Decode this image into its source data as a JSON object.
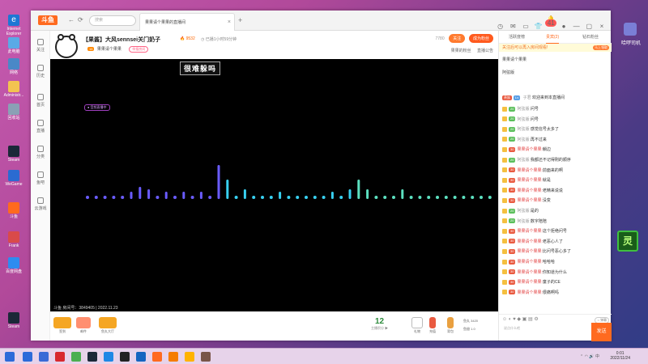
{
  "desktop": {
    "icons": [
      {
        "label": "Internet Explorer",
        "color": "#1e77d4"
      },
      {
        "label": "此电脑",
        "color": "#5aa9e6"
      },
      {
        "label": "网络",
        "color": "#4a88c7"
      },
      {
        "label": "Administr...",
        "color": "#f3c350"
      },
      {
        "label": "回收站",
        "color": "#8aa0b5"
      },
      {
        "label": "Steam",
        "color": "#1b2838"
      },
      {
        "label": "WeGame",
        "color": "#2b6bd1"
      },
      {
        "label": "斗鱼",
        "color": "#ff6a1f"
      },
      {
        "label": "Frank",
        "color": "#d94a4a"
      },
      {
        "label": "百度网盘",
        "color": "#2d8cf0"
      },
      {
        "label": "Steam",
        "color": "#1b2838"
      }
    ],
    "right_label": "哈啰司机"
  },
  "browser": {
    "logo": "斗鱼",
    "search_placeholder": "搜索",
    "tab_title": "果果请个果果的直播间",
    "notification_count": "41"
  },
  "sidebar": {
    "items": [
      {
        "label": "关注"
      },
      {
        "label": "历史"
      },
      {
        "label": "首页"
      },
      {
        "label": "直播"
      },
      {
        "label": "分类"
      },
      {
        "label": "鱼吧"
      },
      {
        "label": "云游戏"
      }
    ]
  },
  "room": {
    "title": "【果酱】大风sennsei关门奶子",
    "hot": "9532",
    "follow_time": "已播1小时59分钟",
    "streamer_level": "16",
    "streamer_name": "果果请个果果",
    "report_label": "举报房间",
    "fans_count": "7780",
    "follow_label": "关注",
    "subscribe_label": "成为粉丝",
    "level_label": "果果的粉丝",
    "announce_label": "直播公告"
  },
  "video": {
    "overlay_title": "很难躲吗",
    "playing_tag": "● 音频直播中",
    "footer": "斗鱼 房间号：3849405 | 2022.11.23"
  },
  "bottom_bar": {
    "items": [
      {
        "label": "签到",
        "color": "#f5a623"
      },
      {
        "label": "邮件",
        "color": "#ff8f70"
      },
      {
        "label": "鱼丸大厅",
        "color": "#f5a623"
      }
    ],
    "score": "12",
    "score_label": "主播积分 ▶",
    "gift_label": "礼物",
    "charge_label": "充值",
    "backpack_label": "背包",
    "fish_balls_label": "鱼丸",
    "fish_balls_value": "3420",
    "fish_wings_label": "鱼翅",
    "fish_wings_value": "1.0"
  },
  "right_panel": {
    "tabs": [
      {
        "label": "活跃度榜"
      },
      {
        "label": "贵宾(2)"
      },
      {
        "label": "钻石粉丝"
      }
    ],
    "notice": "关注后可以再入房间观看!",
    "notice_btn": "马上领取",
    "line1": "果果请个果果",
    "line2": "阿弦版",
    "welcome_prefix": "欢迎来到本直播间",
    "welcome_user": "子君",
    "messages": [
      {
        "level": "20",
        "lv_color": "green",
        "user": "阿弦版:",
        "user_red": false,
        "text": "问号"
      },
      {
        "level": "20",
        "lv_color": "green",
        "user": "阿弦版:",
        "user_red": false,
        "text": "问号"
      },
      {
        "level": "20",
        "lv_color": "green",
        "user": "阿弦版:",
        "user_red": false,
        "text": "感觉信号太多了"
      },
      {
        "level": "20",
        "lv_color": "green",
        "user": "阿弦版:",
        "user_red": false,
        "text": "再不过来"
      },
      {
        "level": "30",
        "lv_color": "red",
        "user": "果果请个果果:",
        "user_red": true,
        "text": "躺边"
      },
      {
        "level": "20",
        "lv_color": "green",
        "user": "阿弦版:",
        "user_red": false,
        "text": "我都还不记得刚的顺序"
      },
      {
        "level": "30",
        "lv_color": "red",
        "user": "果果请个果果:",
        "user_red": true,
        "text": "前面来的啊"
      },
      {
        "level": "30",
        "lv_color": "red",
        "user": "果果请个果果:",
        "user_red": true,
        "text": "就是"
      },
      {
        "level": "30",
        "lv_color": "red",
        "user": "果果请个果果:",
        "user_red": true,
        "text": "老精来说说"
      },
      {
        "level": "30",
        "lv_color": "red",
        "user": "果果请个果果:",
        "user_red": true,
        "text": "没变"
      },
      {
        "level": "20",
        "lv_color": "green",
        "user": "阿弦版:",
        "user_red": false,
        "text": "是的"
      },
      {
        "level": "20",
        "lv_color": "green",
        "user": "阿弦版:",
        "user_red": false,
        "text": "数字陪陪"
      },
      {
        "level": "30",
        "lv_color": "red",
        "user": "果果请个果果:",
        "user_red": true,
        "text": "这个拒绝问号"
      },
      {
        "level": "30",
        "lv_color": "red",
        "user": "果果请个果果:",
        "user_red": true,
        "text": "老恶心人了"
      },
      {
        "level": "30",
        "lv_color": "red",
        "user": "果果请个果果:",
        "user_red": true,
        "text": "比问号恶心多了"
      },
      {
        "level": "30",
        "lv_color": "red",
        "user": "果果请个果果:",
        "user_red": true,
        "text": "哈哈哈"
      },
      {
        "level": "30",
        "lv_color": "red",
        "user": "果果请个果果:",
        "user_red": true,
        "text": "你知道为什么"
      },
      {
        "level": "30",
        "lv_color": "red",
        "user": "果果请个果果:",
        "user_red": true,
        "text": "童子的CE"
      },
      {
        "level": "30",
        "lv_color": "red",
        "user": "果果请个果果:",
        "user_red": true,
        "text": "很痛啊吗"
      }
    ],
    "input_placeholder": "说点什么吧",
    "send_label": "发送",
    "toggle_label": "○ 弹幕",
    "hp_glyph": "灵"
  },
  "taskbar": {
    "icons": [
      {
        "color": "#2c6bd9"
      },
      {
        "color": "#3a6ad6"
      },
      {
        "color": "#d8282e"
      },
      {
        "color": "#4caf50"
      },
      {
        "color": "#1b2838"
      },
      {
        "color": "#1e88e5"
      },
      {
        "color": "#222222"
      },
      {
        "color": "#1565c0"
      },
      {
        "color": "#ff6a1f"
      },
      {
        "color": "#f57c00"
      },
      {
        "color": "#ffb300"
      },
      {
        "color": "#795548"
      }
    ],
    "time": "0:01",
    "date": "2022/11/24"
  },
  "visualizer": {
    "bar_heights": [
      2,
      2,
      2,
      2,
      2,
      3,
      5,
      4,
      2,
      3,
      2,
      3,
      2,
      3,
      2,
      14,
      8,
      2,
      4,
      2,
      2,
      2,
      3,
      2,
      2,
      2,
      2,
      2,
      3,
      2,
      4,
      8,
      4,
      2,
      2,
      2,
      4,
      2,
      2,
      2,
      2,
      2,
      2,
      2,
      2,
      2,
      2
    ],
    "colors": [
      "#6a5cff",
      "#38d0f0",
      "#5ce0c0"
    ]
  },
  "colors": {
    "accent": "#ff6a1f",
    "green_lv": "#5bbf5b",
    "red_lv": "#e95a40"
  }
}
